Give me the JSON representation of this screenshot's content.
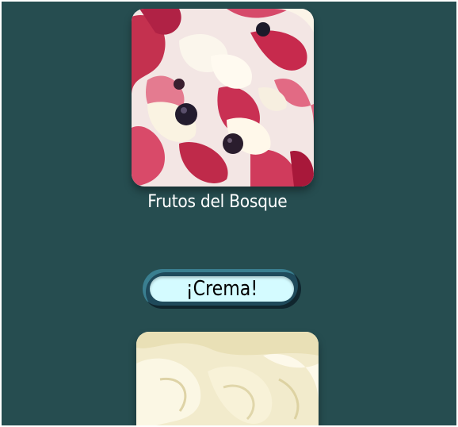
{
  "screen": {
    "background_color": "#264d50"
  },
  "flavors": [
    {
      "name": "Frutos del Bosque",
      "image": "berry-ice-cream-photo"
    },
    {
      "name": "",
      "image": "cream-ice-cream-photo"
    }
  ],
  "category_button": {
    "label": "¡Crema!",
    "color": "#d4fbff"
  }
}
